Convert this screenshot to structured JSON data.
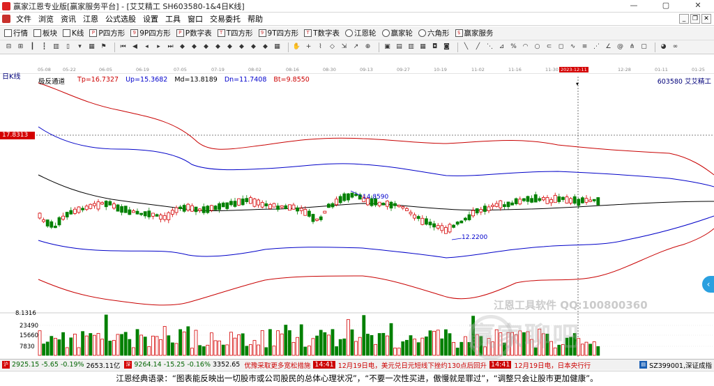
{
  "window": {
    "title": "赢家江恩专业版[赢家服务平台] - [艾艾精工  SH603580-1&4日K线]",
    "buttons": [
      "—",
      "▢",
      "✕"
    ]
  },
  "menu": {
    "items": [
      "文件",
      "浏览",
      "资讯",
      "江恩",
      "公式选股",
      "设置",
      "工具",
      "窗口",
      "交易委托",
      "帮助"
    ],
    "mdi_buttons": [
      "_",
      "❐",
      "✕"
    ]
  },
  "toolbar1": {
    "items": [
      {
        "label": "行情",
        "icon": "grid-icon"
      },
      {
        "label": "板块",
        "icon": "blocks-icon"
      },
      {
        "label": "K线",
        "icon": "kline-icon"
      },
      {
        "label": "P四方形",
        "icon": "p-square-icon"
      },
      {
        "label": "9P四方形",
        "icon": "9p-square-icon"
      },
      {
        "label": "P数字表",
        "icon": "p-table-icon"
      },
      {
        "label": "T四方形",
        "icon": "t-square-icon"
      },
      {
        "label": "9T四方形",
        "icon": "9t-square-icon"
      },
      {
        "label": "T数字表",
        "icon": "t-table-icon"
      },
      {
        "label": "江恩轮",
        "icon": "gann-wheel-icon"
      },
      {
        "label": "赢家轮",
        "icon": "winner-wheel-icon"
      },
      {
        "label": "六角形",
        "icon": "hexagon-icon"
      },
      {
        "label": "赢家服务",
        "icon": "service-icon"
      }
    ]
  },
  "chart": {
    "period_label": "日K线",
    "indicator_name": "极反通道",
    "tp": "Tp=16.7327",
    "up": "Up=15.3682",
    "md": "Md=13.8189",
    "dn": "Dn=11.7408",
    "bt": "Bt=9.8550",
    "stock": "603580  艾艾精工",
    "price_tag": "17.8313",
    "high_label": "14.8590",
    "low_label": "12.2200",
    "volume_scale_top": "8.1316",
    "volume_ticks": [
      "23490",
      "15660",
      "7830"
    ],
    "crosshair_date": "2023-12-11",
    "dates": [
      "05-08",
      "05-22",
      "06-05",
      "06-19",
      "07-05",
      "07-19",
      "08-02",
      "08-16",
      "08-30",
      "09-13",
      "09-27",
      "10-19",
      "11-02",
      "11-16",
      "11-30",
      "2023-12-11",
      "12-28",
      "01-11",
      "01-25"
    ],
    "colors": {
      "up": "#d40000",
      "down": "#008000",
      "upper_band": "#0000c8",
      "outer_band": "#c80000",
      "mid": "#000000"
    }
  },
  "watermark": {
    "line1": "江恩工具软件  QQ:100800360",
    "line2": "赢家聊吧"
  },
  "status": {
    "sh_index": "2925.15",
    "sh_change": "-5.65",
    "sh_pct": "-0.19%",
    "sh_amount": "2653.11亿",
    "sz_index": "9264.14",
    "sz_change": "-15.25",
    "sz_pct": "-0.16%",
    "sz_amount": "3352.65",
    "news1": "优豫采取更多宽松措施",
    "news_time1": "14:41",
    "news_text1": "12月19日电，美元兑日元短线下挫约130点后回升",
    "news_time2": "14:41",
    "news_text2": "12月19日电，日本央行行",
    "index_code": "SZ399001,深证成指"
  },
  "quote": {
    "text": "江恩经典语录：“图表能反映出一切股市或公司股民的总体心理状况”，“不要一次性买进，傲慢就是罪过”，“调整只会让股市更加健康”。"
  }
}
